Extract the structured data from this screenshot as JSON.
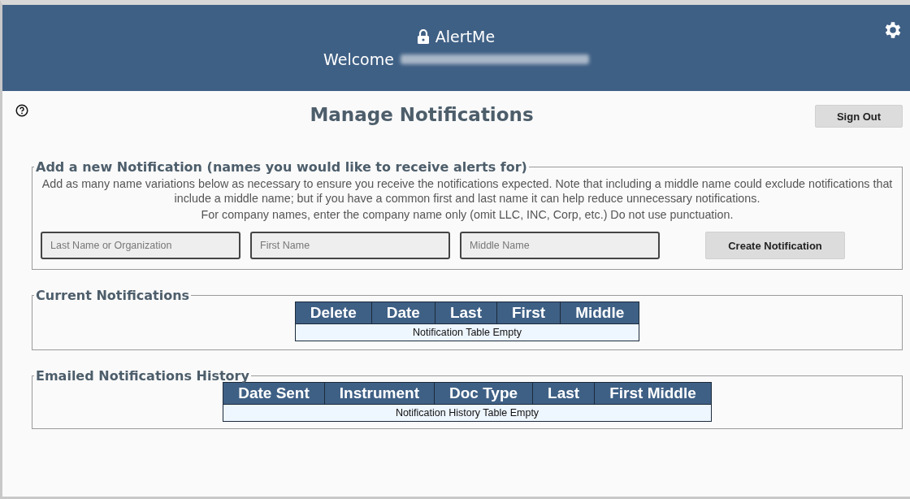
{
  "header": {
    "app_name": "AlertMe",
    "welcome": "Welcome"
  },
  "title": "Manage Notifications",
  "sign_out": "Sign Out",
  "add_section": {
    "legend": "Add a new Notification (names you would like to receive alerts for)",
    "instructions": [
      "Add as many name variations below as necessary to ensure you receive the notifications expected. Note that including a middle name could exclude notifications that include a middle name; but if you have a common first and last name it can help reduce unnecessary notifications.",
      "For company names, enter the company name only (omit LLC, INC, Corp, etc.) Do not use punctuation."
    ],
    "fields": [
      {
        "placeholder": "Last Name or Organization"
      },
      {
        "placeholder": "First Name"
      },
      {
        "placeholder": "Middle Name"
      }
    ],
    "button": "Create Notification"
  },
  "tables": [
    {
      "legend": "Current Notifications",
      "columns": [
        "Delete",
        "Date",
        "Last",
        "First",
        "Middle"
      ],
      "empty": "Notification Table Empty"
    },
    {
      "legend": "Emailed Notifications History",
      "columns": [
        "Date Sent",
        "Instrument",
        "Doc Type",
        "Last",
        "First Middle"
      ],
      "empty": "Notification History Table Empty"
    }
  ]
}
